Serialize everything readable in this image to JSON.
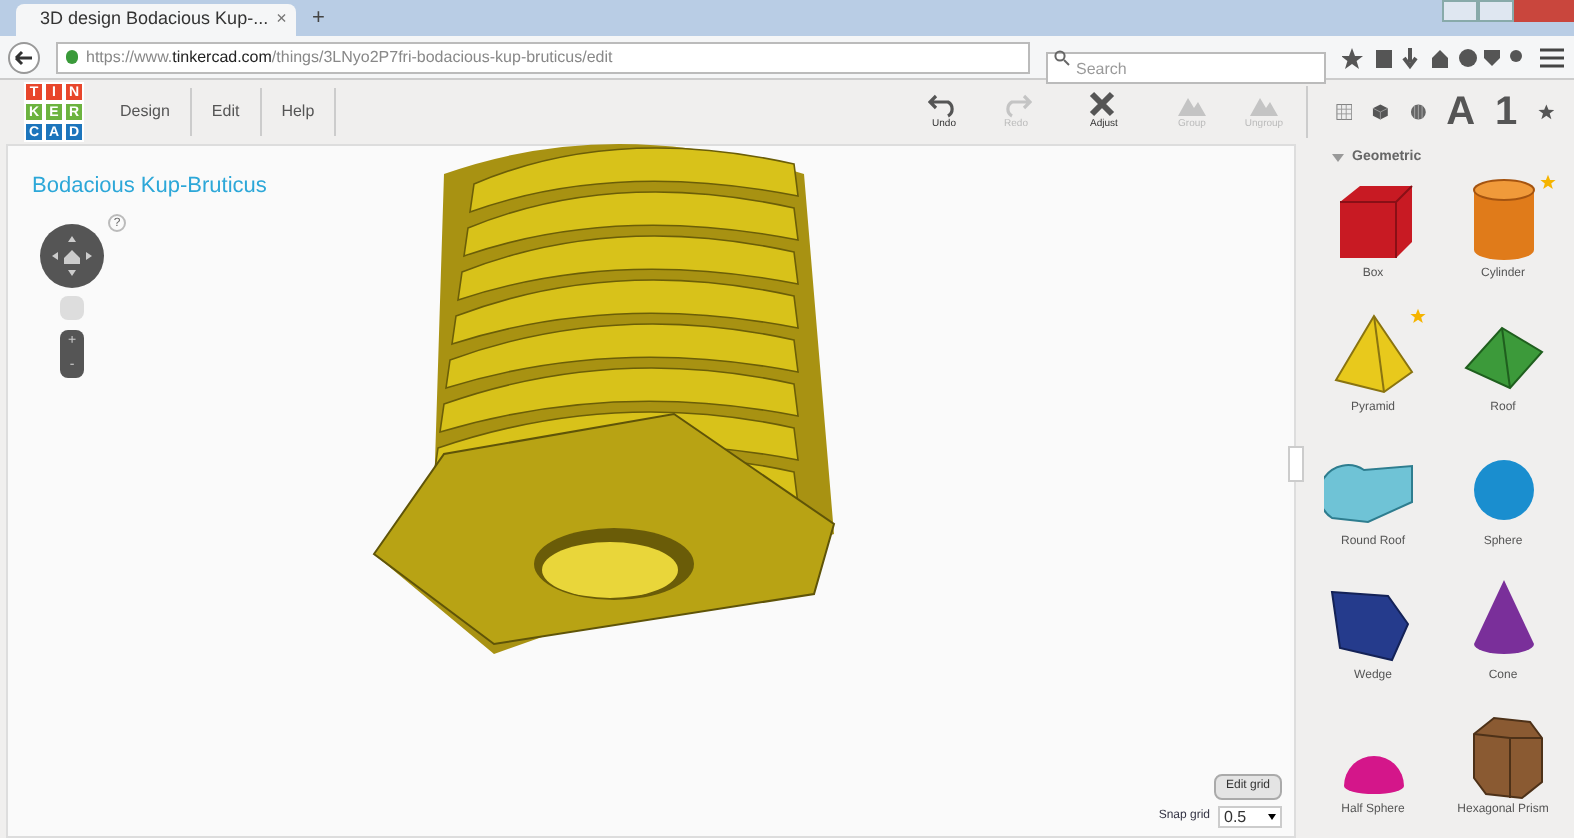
{
  "browser": {
    "tab_title": "3D design Bodacious Kup-...",
    "tab_close": "×",
    "new_tab": "+",
    "url_prefix": "https://www.",
    "url_domain": "tinkercad.com",
    "url_path": "/things/3LNyo2P7fri-bodacious-kup-bruticus/edit",
    "search_placeholder": "Search"
  },
  "logo": {
    "letters": [
      "T",
      "I",
      "N",
      "K",
      "E",
      "R",
      "C",
      "A",
      "D"
    ]
  },
  "menu": [
    "Design",
    "Edit",
    "Help"
  ],
  "toolbar": [
    {
      "label": "Undo",
      "kind": "undo",
      "disabled": false
    },
    {
      "label": "Redo",
      "kind": "redo",
      "disabled": true
    },
    {
      "label": "Adjust",
      "kind": "adjust",
      "disabled": false
    },
    {
      "label": "Group",
      "kind": "group",
      "disabled": true
    },
    {
      "label": "Ungroup",
      "kind": "ungroup",
      "disabled": true
    }
  ],
  "view_tools": [
    {
      "kind": "grid"
    },
    {
      "kind": "cube"
    },
    {
      "kind": "ball"
    },
    {
      "kind": "text",
      "label": "A"
    },
    {
      "kind": "text",
      "label": "1"
    },
    {
      "kind": "star"
    }
  ],
  "design_title": "Bodacious Kup-Bruticus",
  "help": "?",
  "zoom": [
    "+",
    "-"
  ],
  "edit_grid": "Edit grid",
  "snap_grid": {
    "label": "Snap grid",
    "value": "0.5"
  },
  "library": {
    "category": "Geometric",
    "shapes": [
      {
        "label": "Box",
        "kind": "box",
        "featured": false
      },
      {
        "label": "Cylinder",
        "kind": "cylinder",
        "featured": true
      },
      {
        "label": "Pyramid",
        "kind": "pyramid",
        "featured": true
      },
      {
        "label": "Roof",
        "kind": "roof",
        "featured": false
      },
      {
        "label": "Round Roof",
        "kind": "roundroof",
        "featured": false
      },
      {
        "label": "Sphere",
        "kind": "sphere",
        "featured": false
      },
      {
        "label": "Wedge",
        "kind": "wedge",
        "featured": false
      },
      {
        "label": "Cone",
        "kind": "cone",
        "featured": false
      },
      {
        "label": "Half Sphere",
        "kind": "halfsphere",
        "featured": false
      },
      {
        "label": "Hexagonal Prism",
        "kind": "hexprism",
        "featured": false
      }
    ]
  }
}
